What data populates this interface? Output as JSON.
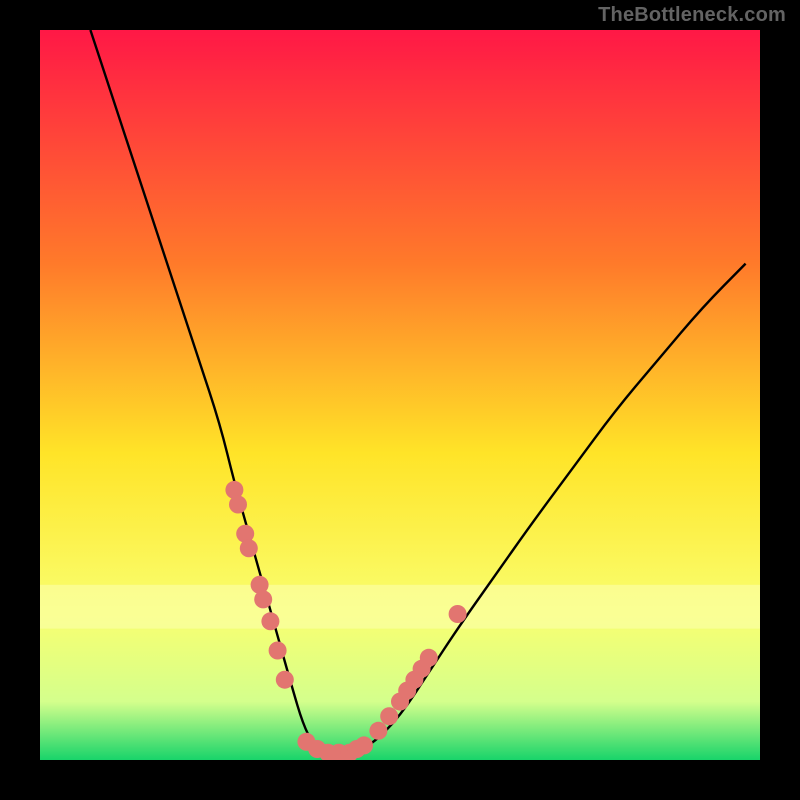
{
  "attribution": "TheBottleneck.com",
  "colors": {
    "gradient_top": "#ff1846",
    "gradient_upper_mid": "#ff7a2a",
    "gradient_mid": "#ffe428",
    "gradient_lower_mid": "#f9ff70",
    "gradient_near_bottom": "#d4ff8c",
    "gradient_bottom": "#18d46a",
    "frame": "#000000",
    "curve": "#000000",
    "marker": "#e27570",
    "yellow_band": "#fbffb2"
  },
  "chart_data": {
    "type": "line",
    "title": "",
    "xlabel": "",
    "ylabel": "",
    "xlim": [
      0,
      100
    ],
    "ylim": [
      0,
      100
    ],
    "series": [
      {
        "name": "bottleneck-curve",
        "x": [
          7,
          10,
          13,
          16,
          19,
          22,
          25,
          27,
          29,
          31,
          33,
          35,
          36.5,
          38,
          40,
          43,
          46,
          50,
          54,
          58,
          63,
          68,
          74,
          80,
          86,
          92,
          98
        ],
        "y": [
          100,
          91,
          82,
          73,
          64,
          55,
          46,
          38,
          31,
          24,
          17,
          10,
          5,
          2,
          1,
          1,
          2,
          6,
          12,
          18,
          25,
          32,
          40,
          48,
          55,
          62,
          68
        ]
      }
    ],
    "markers": [
      {
        "x": 27.0,
        "y": 37
      },
      {
        "x": 27.5,
        "y": 35
      },
      {
        "x": 28.5,
        "y": 31
      },
      {
        "x": 29.0,
        "y": 29
      },
      {
        "x": 30.5,
        "y": 24
      },
      {
        "x": 31.0,
        "y": 22
      },
      {
        "x": 32.0,
        "y": 19
      },
      {
        "x": 33.0,
        "y": 15
      },
      {
        "x": 34.0,
        "y": 11
      },
      {
        "x": 37.0,
        "y": 2.5
      },
      {
        "x": 38.5,
        "y": 1.5
      },
      {
        "x": 40.0,
        "y": 1.0
      },
      {
        "x": 41.5,
        "y": 1.0
      },
      {
        "x": 43.0,
        "y": 1.0
      },
      {
        "x": 44.0,
        "y": 1.5
      },
      {
        "x": 45.0,
        "y": 2.0
      },
      {
        "x": 47.0,
        "y": 4.0
      },
      {
        "x": 48.5,
        "y": 6.0
      },
      {
        "x": 50.0,
        "y": 8.0
      },
      {
        "x": 51.0,
        "y": 9.5
      },
      {
        "x": 52.0,
        "y": 11.0
      },
      {
        "x": 53.0,
        "y": 12.5
      },
      {
        "x": 54.0,
        "y": 14.0
      },
      {
        "x": 58.0,
        "y": 20.0
      }
    ],
    "grid": false,
    "legend": false
  }
}
